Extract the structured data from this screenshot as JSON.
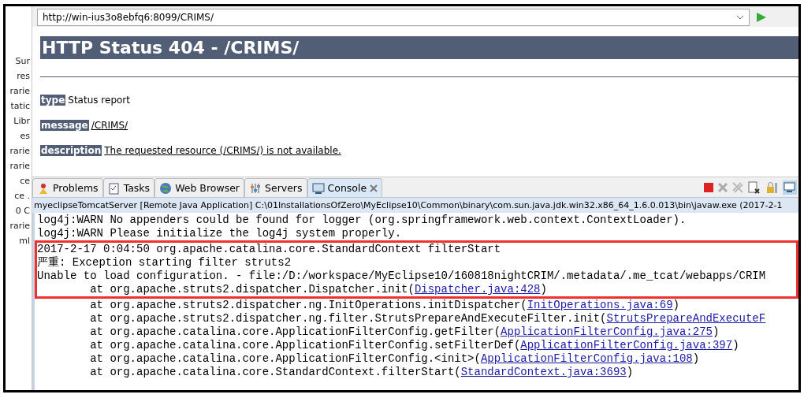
{
  "sidebar": {
    "items": [
      "Sur",
      "res",
      "rarie",
      "tatic",
      "Libr",
      "es",
      "rarie",
      "rarie",
      "ce",
      "ce .",
      "0 C",
      "rarie",
      "ml"
    ]
  },
  "browser": {
    "url": "http://win-ius3o8ebfq6:8099/CRIMS/",
    "page": {
      "title": "HTTP Status 404 - /CRIMS/",
      "fields": [
        {
          "label": "type",
          "value": "Status report",
          "kind": "text"
        },
        {
          "label": "message",
          "value": "/CRIMS/",
          "kind": "link"
        },
        {
          "label": "description",
          "value": "The requested resource (/CRIMS/) is not available.",
          "kind": "link"
        }
      ]
    }
  },
  "tabs": [
    {
      "label": "Problems",
      "selected": false
    },
    {
      "label": "Tasks",
      "selected": false
    },
    {
      "label": "Web Browser",
      "selected": false
    },
    {
      "label": "Servers",
      "selected": false
    },
    {
      "label": "Console",
      "selected": true
    }
  ],
  "console": {
    "header": "myeclipseTomcatServer [Remote Java Application] C:\\01InstallationsOfZero\\MyEclipse10\\Common\\binary\\com.sun.java.jdk.win32.x86_64_1.6.0.013\\bin\\javaw.exe (2017-2-1",
    "lines": [
      {
        "text": "log4j:WARN No appenders could be found for logger (org.springframework.web.context.ContextLoader).",
        "highlighted": false
      },
      {
        "text": "log4j:WARN Please initialize the log4j system properly.",
        "highlighted": false
      },
      {
        "text": "2017-2-17 0:04:50 org.apache.catalina.core.StandardContext filterStart",
        "highlighted": true
      },
      {
        "text": "严重: Exception starting filter struts2",
        "highlighted": true
      },
      {
        "text": "Unable to load configuration. - file:/D:/workspace/MyEclipse10/160818nightCRIM/.metadata/.me_tcat/webapps/CRIM",
        "highlighted": true
      },
      {
        "text": "        at org.apache.struts2.dispatcher.Dispatcher.init(",
        "link": "Dispatcher.java:428",
        "after": ")",
        "highlighted": true
      },
      {
        "text": "        at org.apache.struts2.dispatcher.ng.InitOperations.initDispatcher(",
        "link": "InitOperations.java:69",
        "after": ")",
        "highlighted": false
      },
      {
        "text": "        at org.apache.struts2.dispatcher.ng.filter.StrutsPrepareAndExecuteFilter.init(",
        "link": "StrutsPrepareAndExecuteF",
        "highlighted": false
      },
      {
        "text": "        at org.apache.catalina.core.ApplicationFilterConfig.getFilter(",
        "link": "ApplicationFilterConfig.java:275",
        "after": ")",
        "highlighted": false
      },
      {
        "text": "        at org.apache.catalina.core.ApplicationFilterConfig.setFilterDef(",
        "link": "ApplicationFilterConfig.java:397",
        "after": ")",
        "highlighted": false
      },
      {
        "text": "        at org.apache.catalina.core.ApplicationFilterConfig.<init>(",
        "link": "ApplicationFilterConfig.java:108",
        "after": ")",
        "highlighted": false
      },
      {
        "text": "        at org.apache.catalina.core.StandardContext.filterStart(",
        "link": "StandardContext.java:3693",
        "after": ")",
        "highlighted": false
      }
    ]
  }
}
